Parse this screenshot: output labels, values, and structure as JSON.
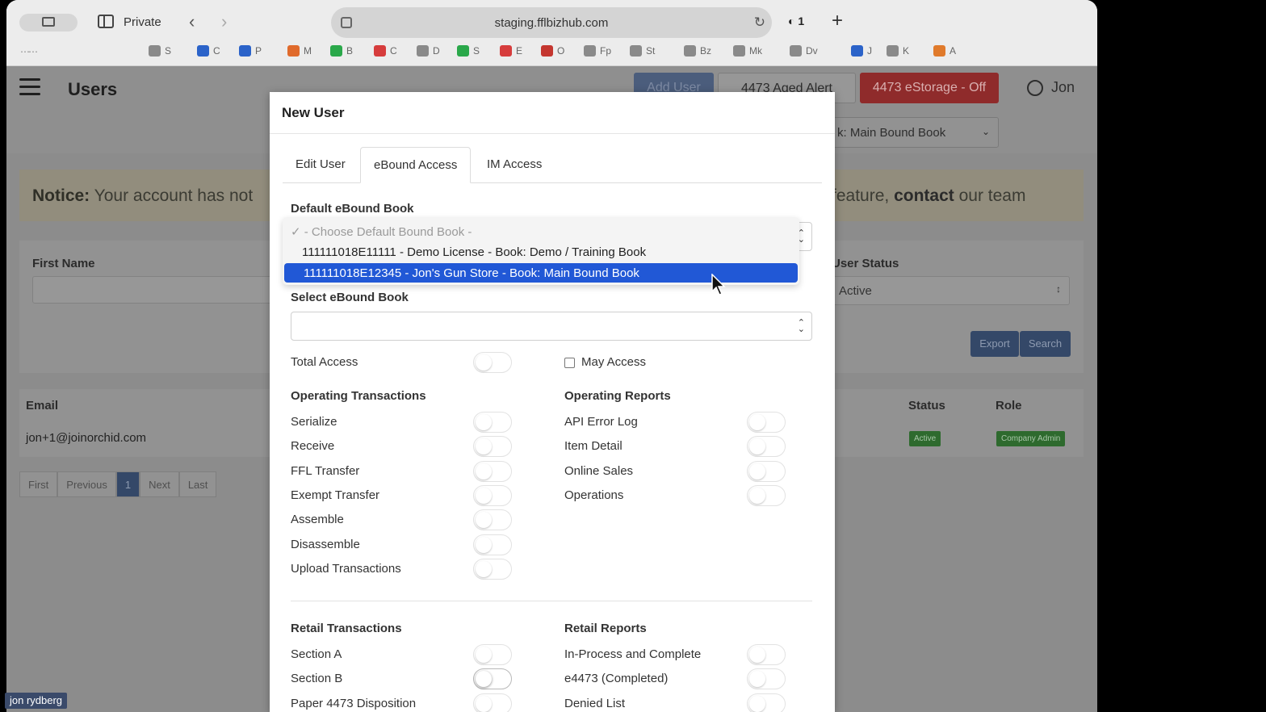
{
  "browser": {
    "private_label": "Private",
    "url": "staging.fflbizhub.com",
    "tab_count": "1",
    "bookmarks": [
      {
        "label": "S",
        "color": "#8a8a8a"
      },
      {
        "label": "C",
        "color": "#2b63c9"
      },
      {
        "label": "P",
        "color": "#2b63c9"
      },
      {
        "label": "M",
        "color": "#e06a2b"
      },
      {
        "label": "B",
        "color": "#2aa84a"
      },
      {
        "label": "C",
        "color": "#d63c3c"
      },
      {
        "label": "D",
        "color": "#8a8a8a"
      },
      {
        "label": "S",
        "color": "#2aa84a"
      },
      {
        "label": "E",
        "color": "#d63c3c"
      },
      {
        "label": "O",
        "color": "#c4362f"
      },
      {
        "label": "Fp",
        "color": "#8a8a8a"
      },
      {
        "label": "St",
        "color": "#8a8a8a"
      },
      {
        "label": "Bz",
        "color": "#8a8a8a"
      },
      {
        "label": "Mk",
        "color": "#8a8a8a"
      },
      {
        "label": "Dv",
        "color": "#8a8a8a"
      },
      {
        "label": "J",
        "color": "#2b63c9"
      },
      {
        "label": "K",
        "color": "#8a8a8a"
      },
      {
        "label": "A",
        "color": "#e07a2b"
      }
    ]
  },
  "header": {
    "title": "Users",
    "add_user": "Add User",
    "aged_alert": "4473 Aged Alert",
    "estorage": "4473 eStorage - Off",
    "user_name": "Jon",
    "book_select": "k: Main Bound Book"
  },
  "notice": {
    "prefix": "Notice:",
    "text": "Your account has not",
    "right_a": "feature,",
    "right_b": "contact",
    "right_c": "our team"
  },
  "filters": {
    "first_name_label": "First Name",
    "user_status_label": "User Status",
    "user_status_value": "Active",
    "export": "Export",
    "search": "Search"
  },
  "table": {
    "email_header": "Email",
    "status_header": "Status",
    "role_header": "Role",
    "rows": [
      {
        "email": "jon+1@joinorchid.com",
        "status": "Active",
        "role": "Company Admin"
      }
    ]
  },
  "pager": {
    "first": "First",
    "previous": "Previous",
    "current": "1",
    "next": "Next",
    "last": "Last"
  },
  "modal": {
    "title": "New User",
    "tabs": [
      "Edit User",
      "eBound Access",
      "IM Access"
    ],
    "default_book_label": "Default eBound Book",
    "dropdown": {
      "placeholder": "- Choose Default Bound Book -",
      "options": [
        "111111018E11111 - Demo License - Book: Demo / Training Book",
        "111111018E12345 - Jon's Gun Store - Book: Main Bound Book"
      ]
    },
    "select_book_label": "Select eBound Book",
    "total_access": "Total Access",
    "may_access": "May Access",
    "operating_transactions": {
      "heading": "Operating Transactions",
      "items": [
        "Serialize",
        "Receive",
        "FFL Transfer",
        "Exempt Transfer",
        "Assemble",
        "Disassemble",
        "Upload Transactions"
      ]
    },
    "operating_reports": {
      "heading": "Operating Reports",
      "items": [
        "API Error Log",
        "Item Detail",
        "Online Sales",
        "Operations"
      ]
    },
    "retail_transactions": {
      "heading": "Retail Transactions",
      "items": [
        "Section A",
        "Section B",
        "Paper 4473 Disposition"
      ]
    },
    "retail_reports": {
      "heading": "Retail Reports",
      "items": [
        "In-Process and Complete",
        "e4473 (Completed)",
        "Denied List"
      ]
    }
  },
  "caption": "jon rydberg"
}
